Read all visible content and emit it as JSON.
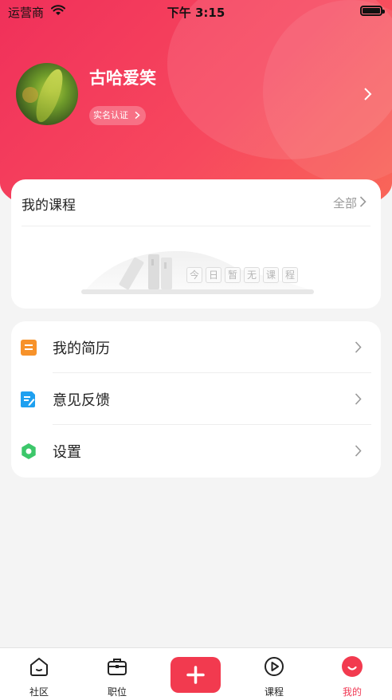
{
  "status_bar": {
    "carrier": "运营商",
    "time": "下午 3:15"
  },
  "profile": {
    "username": "古哈爱笑",
    "verify_label": "实名认证"
  },
  "courses": {
    "title": "我的课程",
    "all_label": "全部",
    "empty_chars": [
      "今",
      "日",
      "暂",
      "无",
      "课",
      "程"
    ]
  },
  "menu": {
    "items": [
      {
        "label": "我的简历",
        "icon": "resume-icon",
        "color": "#f7922a"
      },
      {
        "label": "意见反馈",
        "icon": "feedback-icon",
        "color": "#1ea0f0"
      },
      {
        "label": "设置",
        "icon": "settings-icon",
        "color": "#3cc76a"
      }
    ]
  },
  "tabbar": {
    "tabs": [
      {
        "label": "社区",
        "icon": "home-icon"
      },
      {
        "label": "职位",
        "icon": "briefcase-icon"
      },
      {
        "label": "",
        "icon": "plus-icon"
      },
      {
        "label": "课程",
        "icon": "play-icon"
      },
      {
        "label": "我的",
        "icon": "profile-icon",
        "active": true
      }
    ]
  },
  "colors": {
    "accent": "#f23a4f",
    "header_start": "#f0305a",
    "header_end": "#f96a58"
  }
}
